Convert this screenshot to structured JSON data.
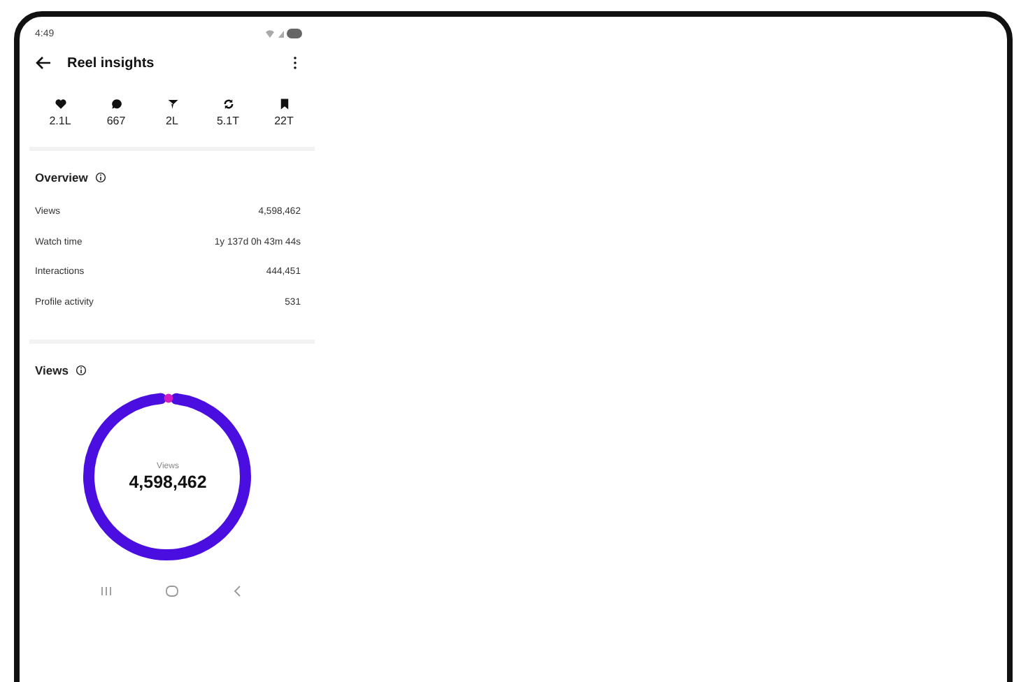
{
  "status_bar": {
    "time": "4:49"
  },
  "header": {
    "title": "Reel insights"
  },
  "stats": [
    {
      "kind": "heart",
      "value": "2.1L"
    },
    {
      "kind": "comment",
      "value": "667"
    },
    {
      "kind": "share",
      "value": "2L"
    },
    {
      "kind": "repost",
      "value": "5.1T"
    },
    {
      "kind": "bookmark",
      "value": "22T"
    }
  ],
  "overview": {
    "title": "Overview",
    "rows": [
      {
        "label": "Views",
        "value": "4,598,462"
      },
      {
        "label": "Watch time",
        "value": "1y 137d 0h 43m 44s"
      },
      {
        "label": "Interactions",
        "value": "444,451"
      },
      {
        "label": "Profile activity",
        "value": "531"
      }
    ]
  },
  "views": {
    "title": "Views",
    "center_label": "Views",
    "center_value": "4,598,462"
  }
}
